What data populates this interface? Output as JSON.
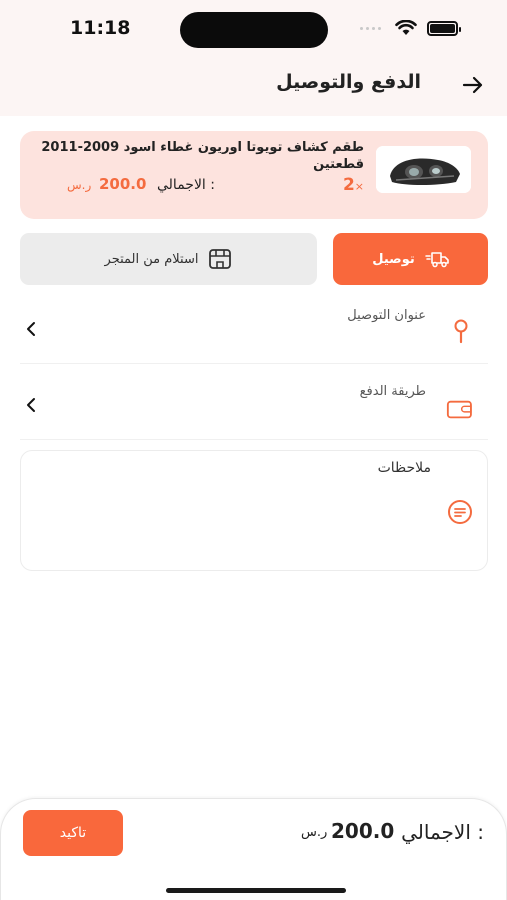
{
  "status_bar": {
    "time": "11:18"
  },
  "header": {
    "title": "الدفع والتوصيل",
    "back_icon": "arrow-right-icon"
  },
  "product": {
    "name": "طقم كشاف تويوتا اوريون غطاء اسود 2009-2011 قطعتين",
    "quantity": "2",
    "quantity_prefix": "×",
    "total_label": "الاجمالي :",
    "total_value": "200.0",
    "currency": "ر.س"
  },
  "delivery_methods": {
    "delivery_label": "توصيل",
    "pickup_label": "استلام من المتجر",
    "selected": "delivery"
  },
  "address_row": {
    "label": "عنوان التوصيل",
    "icon": "map-pin-icon"
  },
  "payment_row": {
    "label": "طريقة الدفع",
    "icon": "wallet-icon"
  },
  "notes": {
    "label": "ملاحظات",
    "icon": "notes-icon"
  },
  "footer": {
    "confirm_label": "تاكيد",
    "total_label": "الاجمالي :",
    "total_value": "200.0",
    "currency": "ر.س"
  },
  "colors": {
    "accent": "#f9683c",
    "card_bg": "#fde3de",
    "header_bg": "#fcf5f4"
  }
}
